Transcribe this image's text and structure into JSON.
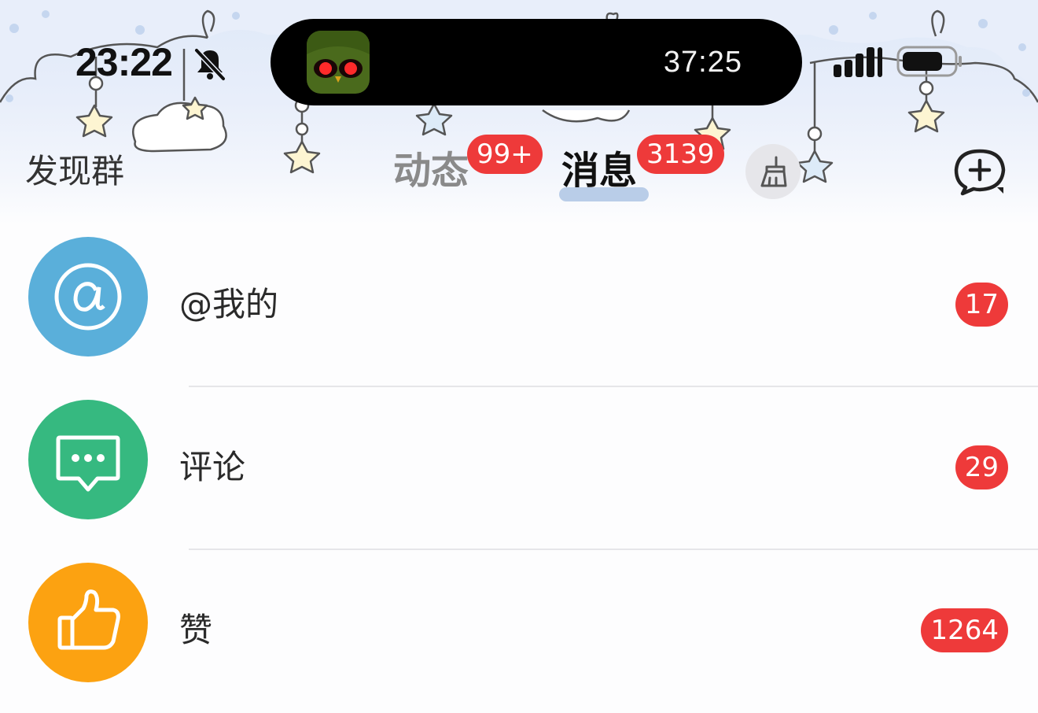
{
  "status_bar": {
    "time": "23:22",
    "live_activity_timer": "37:25",
    "mute_icon": "bell-slash-icon",
    "signal_icon": "cellular-signal-icon",
    "battery_icon": "battery-icon"
  },
  "nav": {
    "discover_label": "发现群",
    "tabs": [
      {
        "label": "动态",
        "badge": "99+",
        "selected": false
      },
      {
        "label": "消息",
        "badge": "3139",
        "selected": true
      }
    ],
    "clear_icon": "broom-icon",
    "add_chat_icon": "chat-plus-icon"
  },
  "messages": [
    {
      "label": "@我的",
      "count": "17",
      "icon": "at-sign-icon",
      "color": "#5aafda"
    },
    {
      "label": "评论",
      "count": "29",
      "icon": "comment-bubble-icon",
      "color": "#36b980"
    },
    {
      "label": "赞",
      "count": "1264",
      "icon": "thumbs-up-icon",
      "color": "#fca211"
    }
  ],
  "colors": {
    "badge_red": "#ee3a3a",
    "tab_underline": "#b9cde8",
    "header_background": "#dfe9f8"
  }
}
